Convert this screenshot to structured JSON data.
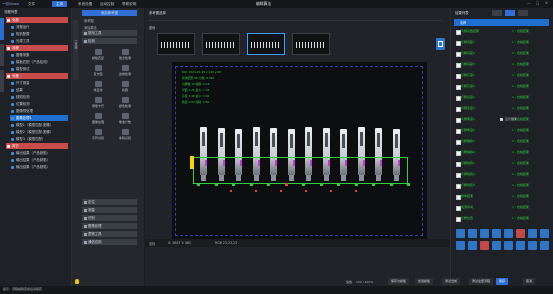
{
  "topbar": {
    "app_label": "一切Vision",
    "menus": [
      "文件",
      "主页",
      "系统设置",
      "运动控制",
      "帮助说明"
    ],
    "active_menu_index": 1,
    "center_title": "编辑算法",
    "window_controls": [
      "—",
      "□",
      "✕"
    ]
  },
  "left_panel": {
    "title": "流程列表",
    "items": [
      {
        "label": "全部",
        "kind": "group"
      },
      {
        "label": "流程运行",
        "kind": "item"
      },
      {
        "label": "相机配置",
        "kind": "item"
      },
      {
        "label": "光源工具",
        "kind": "item"
      },
      {
        "label": "流程",
        "kind": "group"
      },
      {
        "label": "图像采集",
        "kind": "item"
      },
      {
        "label": "模板匹配（产品检测）",
        "kind": "item"
      },
      {
        "label": "模型测试",
        "kind": "item"
      },
      {
        "label": "流程",
        "kind": "group"
      },
      {
        "label": "尺寸测量",
        "kind": "item"
      },
      {
        "label": "结果",
        "kind": "item"
      },
      {
        "label": "缺陷检测",
        "kind": "item"
      },
      {
        "label": "位置检测",
        "kind": "item"
      },
      {
        "label": "图像预处理",
        "kind": "item"
      },
      {
        "label": "图像处理1",
        "kind": "selected"
      },
      {
        "label": "模型1（模型匹配-图像）",
        "kind": "item"
      },
      {
        "label": "模型2（模型匹配-图像）",
        "kind": "item"
      },
      {
        "label": "模型3（模型匹配）",
        "kind": "item"
      },
      {
        "label": "其它",
        "kind": "group"
      },
      {
        "label": "输出结果（产品缺陷）",
        "kind": "item"
      },
      {
        "label": "输出结果（产品缺陷）",
        "kind": "item"
      },
      {
        "label": "输出结果（产品缺陷）",
        "kind": "item"
      }
    ]
  },
  "tool_panel": {
    "header": "添加参考图",
    "sub1": "参考图",
    "sub2": "添加算法",
    "section1": "常用工具",
    "section2": "检测",
    "tools": [
      {
        "label": "模板匹配",
        "icon": "template-icon"
      },
      {
        "label": "斑点检测",
        "icon": "blob-icon"
      },
      {
        "label": "直方图",
        "icon": "histogram-icon"
      },
      {
        "label": "边缘检测",
        "icon": "edge-icon"
      },
      {
        "label": "找直线",
        "icon": "line-icon"
      },
      {
        "label": "找圆",
        "icon": "circle-icon"
      },
      {
        "label": "测量卡尺",
        "icon": "caliper-icon"
      },
      {
        "label": "颜色检测",
        "icon": "color-icon"
      },
      {
        "label": "图像处理",
        "icon": "process-icon"
      },
      {
        "label": "像素计数",
        "icon": "pixel-icon"
      },
      {
        "label": "字符识别",
        "icon": "ocr-icon"
      },
      {
        "label": "条码识别",
        "icon": "barcode-icon"
      }
    ],
    "sections": [
      "定位",
      "测量",
      "识别",
      "图像处理",
      "逻辑工具",
      "通信应用"
    ],
    "vertical_tab": "工具箱"
  },
  "main": {
    "ref_title": "参考图选择",
    "image_title": "图像",
    "thumbnails": 4,
    "selected_thumb": 2,
    "overlay_lines": [
      "ROI: 2021-01-20  x:120 y:48",
      "检测结果  OK   分数: 0.962",
      "引脚数  12   偏移: 0.18",
      "间距  1.25  最大: 1.32",
      "高度  3.48  最小: 3.40",
      "角度  0.02  阈值: 0.50"
    ],
    "status_left_label": "坐标",
    "status_coord": "X: 2867  Y: 985",
    "status_rgb": "RGB 23,23,23",
    "status_zoom": "100%"
  },
  "right_panel": {
    "tabs": [
      "结果列表",
      "",
      ""
    ],
    "col_name": "名称",
    "col_value": "数值",
    "rows": [
      {
        "name": "引脚总数结果",
        "value": "1 - 合格结果"
      },
      {
        "name": "引脚间距1",
        "value": "1 - 合格结果"
      },
      {
        "name": "引脚间距2",
        "value": "1 - 合格结果"
      },
      {
        "name": "引脚间距3",
        "value": "1 - 合格结果"
      },
      {
        "name": "引脚高度1",
        "value": "1 - 合格结果"
      },
      {
        "name": "引脚高度2",
        "value": "1 - 合格结果"
      },
      {
        "name": "引脚宽度1",
        "value": "1 - 合格结果"
      },
      {
        "name": "引脚宽度2",
        "value": "1 - 合格结果"
      },
      {
        "name": "引脚角度1",
        "value": "1 - 合格结果"
      },
      {
        "name": "引脚角度2",
        "value": "1 - 合格结果"
      },
      {
        "name": "引脚偏移1",
        "value": "1 - 合格结果"
      },
      {
        "name": "引脚偏移2",
        "value": "1 - 合格结果"
      },
      {
        "name": "引脚缺陷1",
        "value": "1 - 合格结果"
      },
      {
        "name": "引脚缺陷2",
        "value": "1 - 合格结果"
      },
      {
        "name": "引脚缺陷3",
        "value": "1 - 合格结果"
      },
      {
        "name": "整体结果",
        "value": "1 - 合格结果"
      },
      {
        "name": "检测时间",
        "value": "1 - 合格结果"
      },
      {
        "name": "引脚位置",
        "value": "1 - 合格结果"
      }
    ],
    "checkbox_label": "显示结果"
  },
  "bottom": {
    "hint": "提示：流程编辑完成后请保存",
    "zoom_label": "缩放",
    "zoom_value": "100 / 100%",
    "buttons": [
      "保存为模板",
      "加载模板",
      "测试当前",
      "测试全部流程",
      "保存",
      "取消"
    ],
    "primary_index": 4
  },
  "colors": {
    "accent": "#2f6fd6",
    "group": "#c94b4b",
    "ok_green": "#2bd13c"
  }
}
